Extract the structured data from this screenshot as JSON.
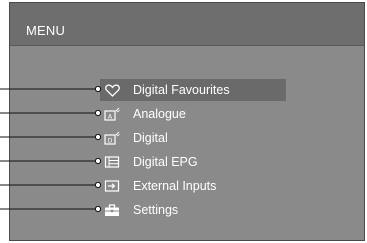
{
  "menu": {
    "title": "MENU",
    "items": [
      {
        "label": "Digital Favourites",
        "icon": "heart-icon",
        "selected": true
      },
      {
        "label": "Analogue",
        "icon": "analogue-tv-icon",
        "selected": false
      },
      {
        "label": "Digital",
        "icon": "digital-tv-icon",
        "selected": false
      },
      {
        "label": "Digital EPG",
        "icon": "epg-icon",
        "selected": false
      },
      {
        "label": "External Inputs",
        "icon": "external-input-icon",
        "selected": false
      },
      {
        "label": "Settings",
        "icon": "toolbox-icon",
        "selected": false
      }
    ]
  },
  "colors": {
    "background": "#8a8a8a",
    "title_bar": "#6e6e6e",
    "selection": "#6a6a6a",
    "text": "#ffffff",
    "callout_line": "#111111"
  }
}
